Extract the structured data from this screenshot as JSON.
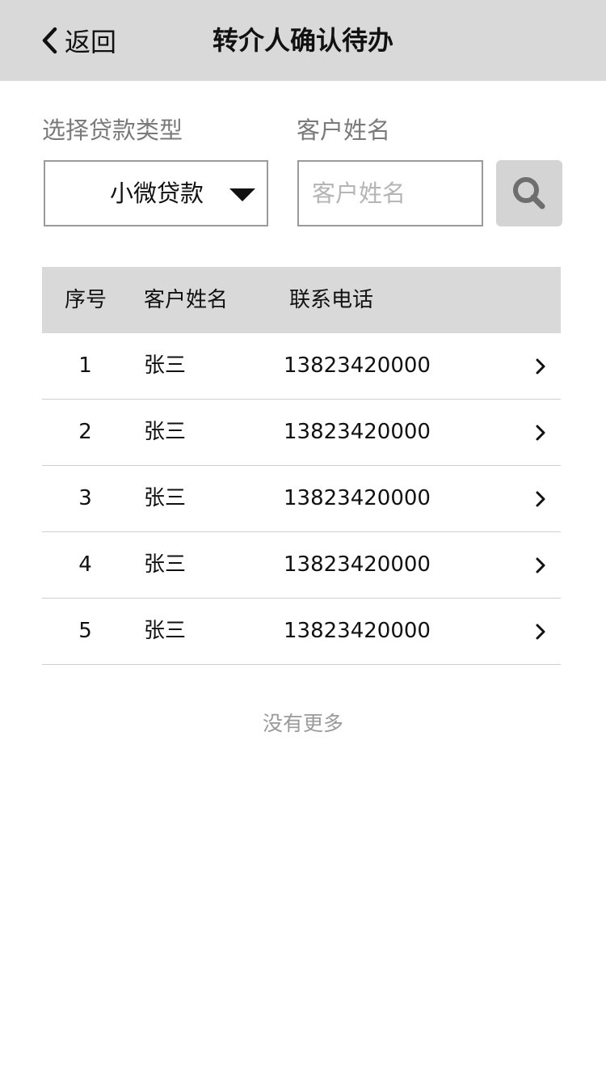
{
  "header": {
    "back_label": "返回",
    "title": "转介人确认待办",
    "background": "#d9d9d9"
  },
  "filters": {
    "loan_type_label": "选择贷款类型",
    "loan_type_value": "小微贷款",
    "customer_name_label": "客户姓名",
    "customer_name_placeholder": "客户姓名",
    "customer_name_value": "",
    "search_icon": "search-icon"
  },
  "table": {
    "headers": {
      "index": "序号",
      "name": "客户姓名",
      "phone": "联系电话"
    },
    "rows": [
      {
        "index": "1",
        "name": "张三",
        "phone": "13823420000"
      },
      {
        "index": "2",
        "name": "张三",
        "phone": "13823420000"
      },
      {
        "index": "3",
        "name": "张三",
        "phone": "13823420000"
      },
      {
        "index": "4",
        "name": "张三",
        "phone": "13823420000"
      },
      {
        "index": "5",
        "name": "张三",
        "phone": "13823420000"
      }
    ],
    "row_icon": "chevron-right-icon"
  },
  "footer": {
    "no_more_text": "没有更多"
  }
}
